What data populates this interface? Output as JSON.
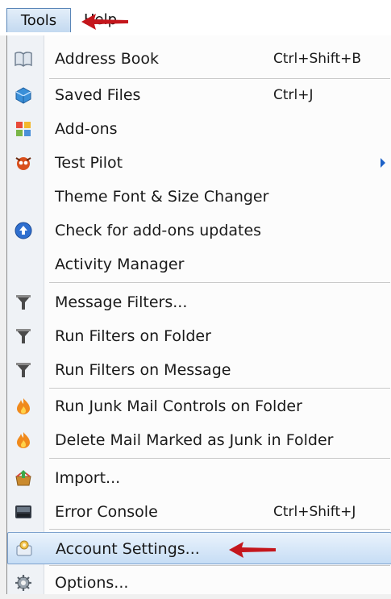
{
  "menubar": {
    "tools_label": "Tools",
    "help_label": "Help"
  },
  "menu": {
    "items": [
      {
        "label": "Address Book",
        "accel": "Ctrl+Shift+B",
        "icon": "address-book-icon"
      },
      {
        "label": "Saved Files",
        "accel": "Ctrl+J",
        "icon": "saved-files-icon"
      },
      {
        "label": "Add-ons",
        "accel": "",
        "icon": "add-ons-icon"
      },
      {
        "label": "Test Pilot",
        "accel": "",
        "icon": "test-pilot-icon",
        "submenu": true
      },
      {
        "label": "Theme Font & Size Changer",
        "accel": "",
        "icon": ""
      },
      {
        "label": "Check for add-ons updates",
        "accel": "",
        "icon": "update-check-icon"
      },
      {
        "label": "Activity Manager",
        "accel": "",
        "icon": ""
      },
      {
        "label": "Message Filters...",
        "accel": "",
        "icon": "filter-funnel-icon"
      },
      {
        "label": "Run Filters on Folder",
        "accel": "",
        "icon": "filter-funnel-icon"
      },
      {
        "label": "Run Filters on Message",
        "accel": "",
        "icon": "filter-funnel-icon"
      },
      {
        "label": "Run Junk Mail Controls on Folder",
        "accel": "",
        "icon": "junk-flame-icon"
      },
      {
        "label": "Delete Mail Marked as Junk in Folder",
        "accel": "",
        "icon": "junk-flame-icon"
      },
      {
        "label": "Import...",
        "accel": "",
        "icon": "import-box-icon"
      },
      {
        "label": "Error Console",
        "accel": "Ctrl+Shift+J",
        "icon": "error-console-icon"
      },
      {
        "label": "Account Settings...",
        "accel": "",
        "icon": "account-settings-icon",
        "highlighted": true
      },
      {
        "label": "Options...",
        "accel": "",
        "icon": "options-gear-icon"
      }
    ]
  },
  "colors": {
    "highlight": "#c6ddf5",
    "annotation_arrow": "#c4161c",
    "submenu_arrow": "#1e62c8"
  }
}
